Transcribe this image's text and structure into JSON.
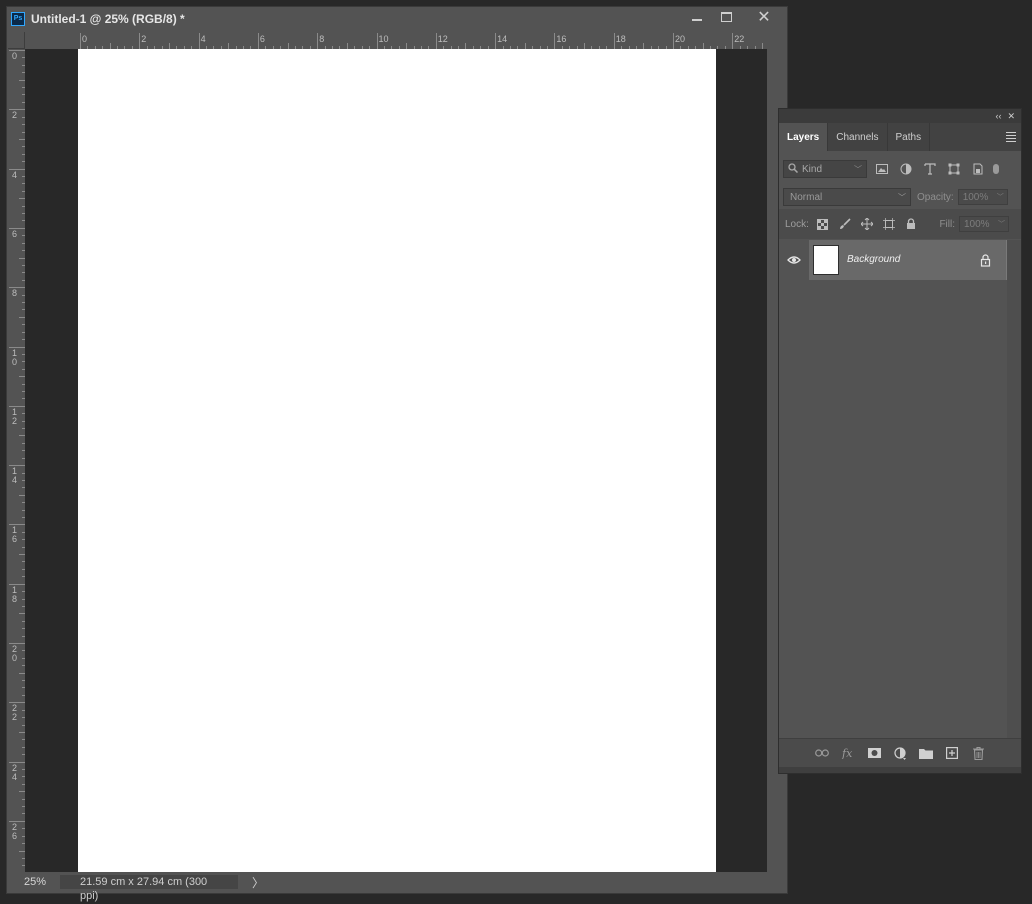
{
  "document": {
    "app_badge": "Ps",
    "title": "Untitled-1 @ 25% (RGB/8) *",
    "window_buttons": {
      "minimize": "minimize",
      "maximize": "maximize",
      "close": "✕"
    }
  },
  "rulers": {
    "top_labels": [
      "0",
      "2",
      "4",
      "6",
      "8",
      "10",
      "12",
      "14",
      "16",
      "18",
      "20",
      "22"
    ],
    "left_labels": [
      "0",
      "2",
      "4",
      "6",
      "8",
      "1\n0",
      "1\n2",
      "1\n4",
      "1\n6",
      "1\n8",
      "2\n0",
      "2\n2",
      "2\n4",
      "2\n6"
    ]
  },
  "status": {
    "zoom": "25%",
    "doc_info": "21.59 cm x 27.94 cm (300 ppi)",
    "arrow": "〉"
  },
  "layers_panel": {
    "collapse": "‹‹",
    "close": "✕",
    "tabs": [
      "Layers",
      "Channels",
      "Paths"
    ],
    "active_tab": "Layers",
    "filter": {
      "kind": "Kind"
    },
    "blend_mode": "Normal",
    "opacity_label": "Opacity:",
    "opacity_value": "100%",
    "lock_label": "Lock:",
    "fill_label": "Fill:",
    "fill_value": "100%",
    "layers": [
      {
        "name": "Background",
        "visible": true,
        "locked": true
      }
    ]
  }
}
